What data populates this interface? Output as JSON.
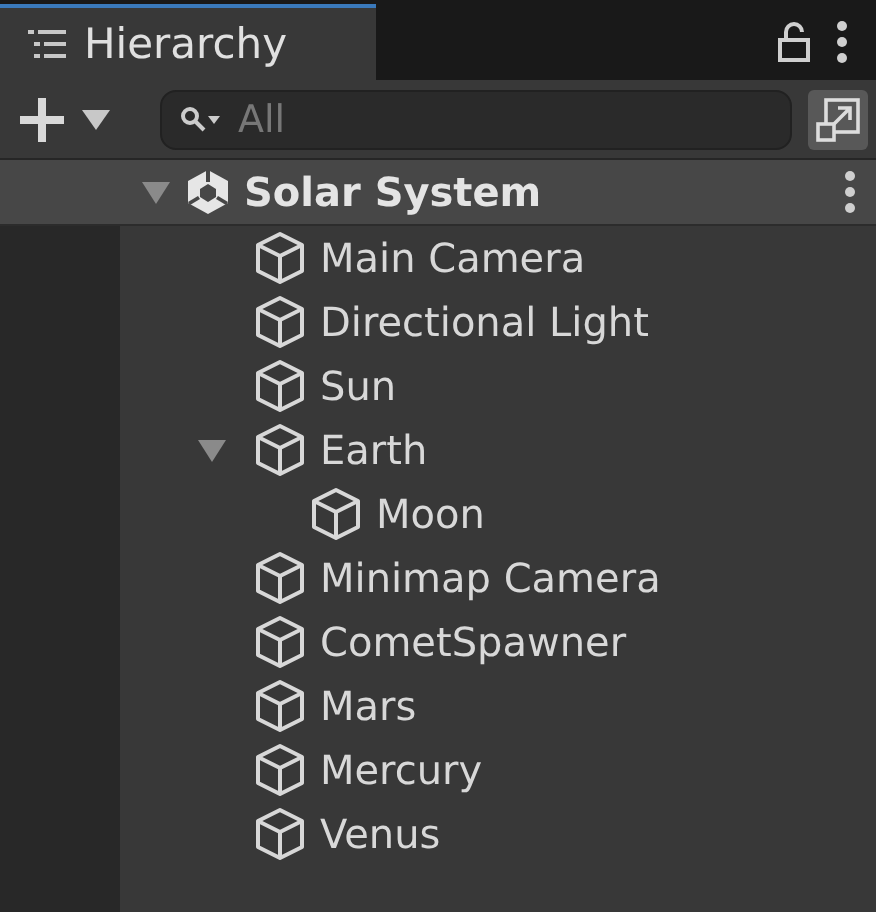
{
  "tab": {
    "title": "Hierarchy",
    "selected": true
  },
  "search": {
    "placeholder": "All"
  },
  "scene": {
    "name": "Solar System",
    "expanded": true,
    "children": [
      {
        "name": "Main Camera"
      },
      {
        "name": "Directional Light"
      },
      {
        "name": "Sun"
      },
      {
        "name": "Earth",
        "expanded": true,
        "children": [
          {
            "name": "Moon"
          }
        ]
      },
      {
        "name": "Minimap Camera"
      },
      {
        "name": "CometSpawner"
      },
      {
        "name": "Mars"
      },
      {
        "name": "Mercury"
      },
      {
        "name": "Venus"
      }
    ]
  }
}
